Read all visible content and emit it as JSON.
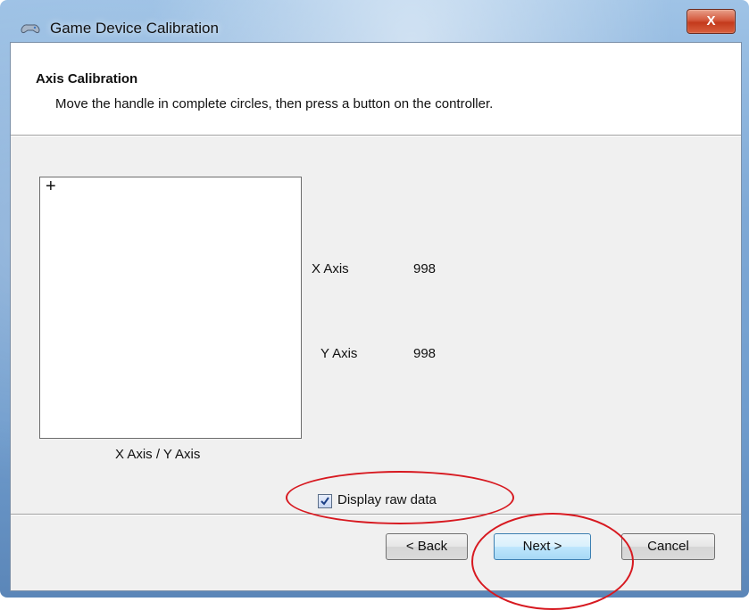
{
  "window": {
    "title": "Game Device Calibration",
    "close_glyph": "X",
    "icon": "game-controller-icon"
  },
  "header": {
    "title": "Axis Calibration",
    "description": "Move the handle in complete circles, then press a button on the controller."
  },
  "plot": {
    "crosshair": "+",
    "label": "X Axis / Y Axis"
  },
  "axes": [
    {
      "label": "X Axis",
      "value": "998"
    },
    {
      "label": "Y Axis",
      "value": "998"
    }
  ],
  "raw_data": {
    "label": "Display raw data",
    "checked": true
  },
  "buttons": {
    "back": "< Back",
    "next": "Next >",
    "cancel": "Cancel"
  },
  "colors": {
    "annotation": "#d71920",
    "frame": "#7fa9d6",
    "close_button": "#c33a1c"
  }
}
